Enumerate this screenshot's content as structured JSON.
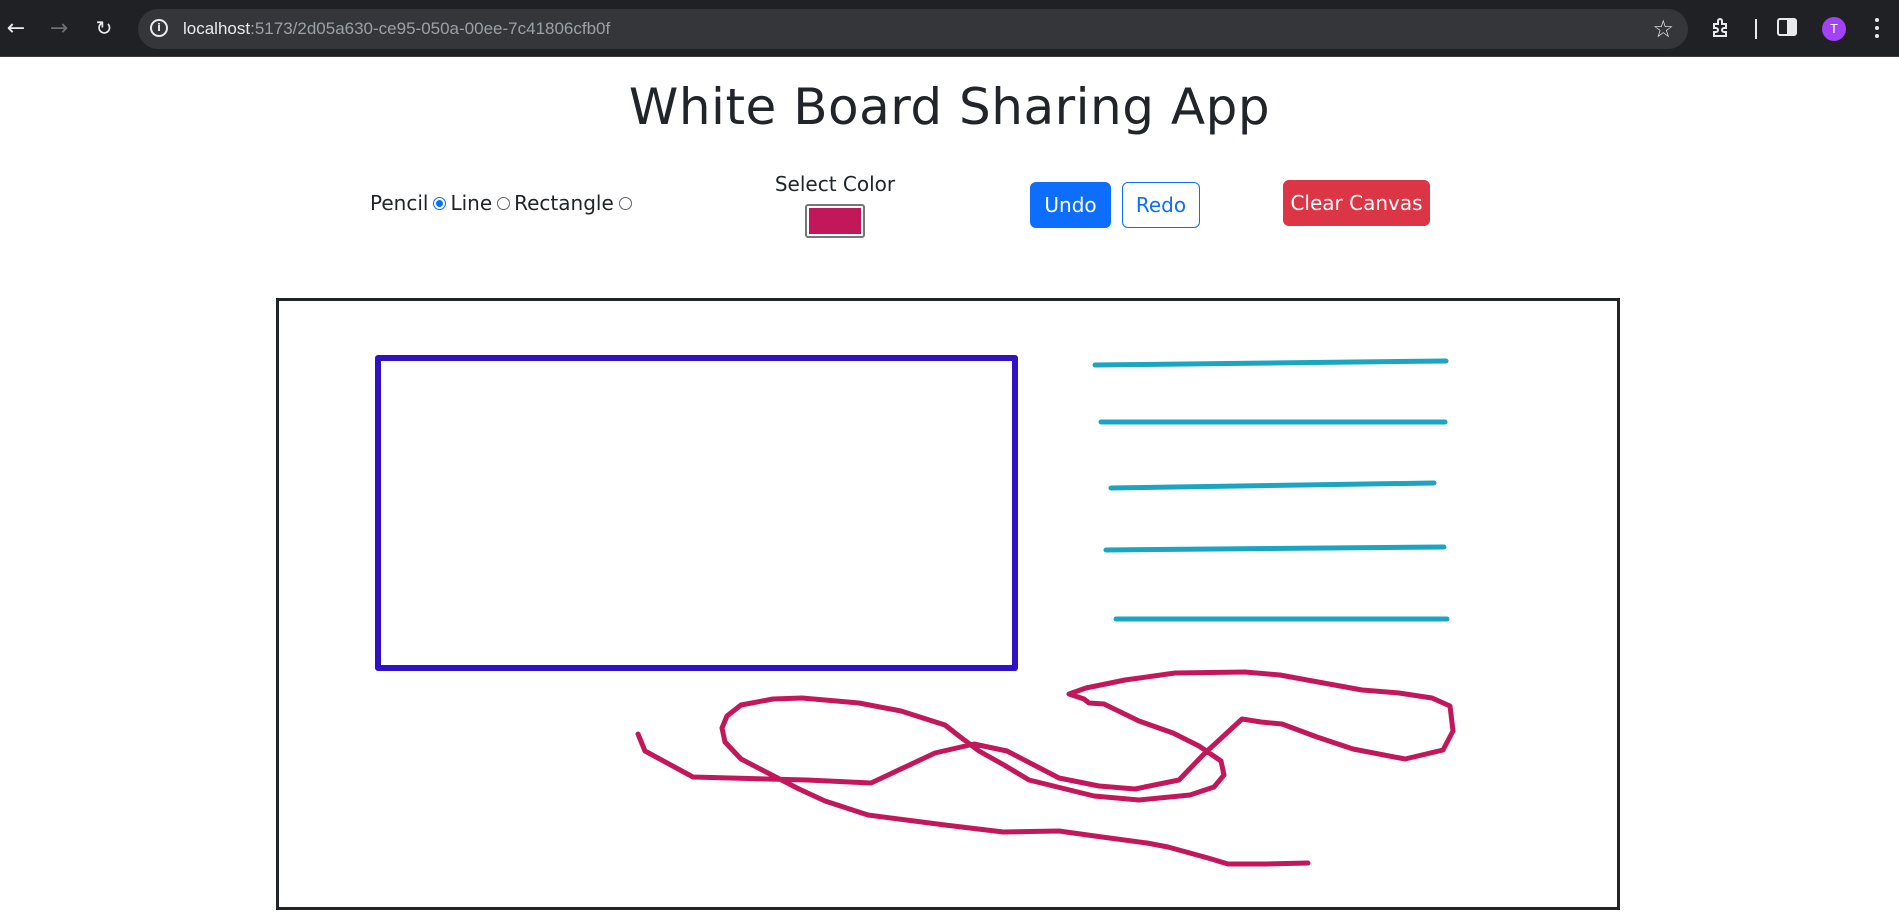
{
  "browser": {
    "url_host": "localhost",
    "url_rest": ":5173/2d05a630-ce95-050a-00ee-7c41806cfb0f",
    "profile_initial": "T"
  },
  "page": {
    "title": "White Board Sharing App"
  },
  "tools": {
    "options": [
      "Pencil",
      "Line",
      "Rectangle"
    ],
    "selected": "Pencil"
  },
  "color": {
    "label": "Select Color",
    "value": "#c2185b"
  },
  "actions": {
    "undo_label": "Undo",
    "redo_label": "Redo",
    "clear_label": "Clear Canvas"
  },
  "canvas": {
    "strokes": [
      {
        "type": "rectangle",
        "color": "#2e12c4"
      },
      {
        "type": "line",
        "color": "#1aa5c2"
      },
      {
        "type": "line",
        "color": "#1aa5c2"
      },
      {
        "type": "line",
        "color": "#1aa5c2"
      },
      {
        "type": "line",
        "color": "#1aa5c2"
      },
      {
        "type": "line",
        "color": "#1aa5c2"
      },
      {
        "type": "pencil",
        "color": "#c2185b"
      }
    ]
  }
}
